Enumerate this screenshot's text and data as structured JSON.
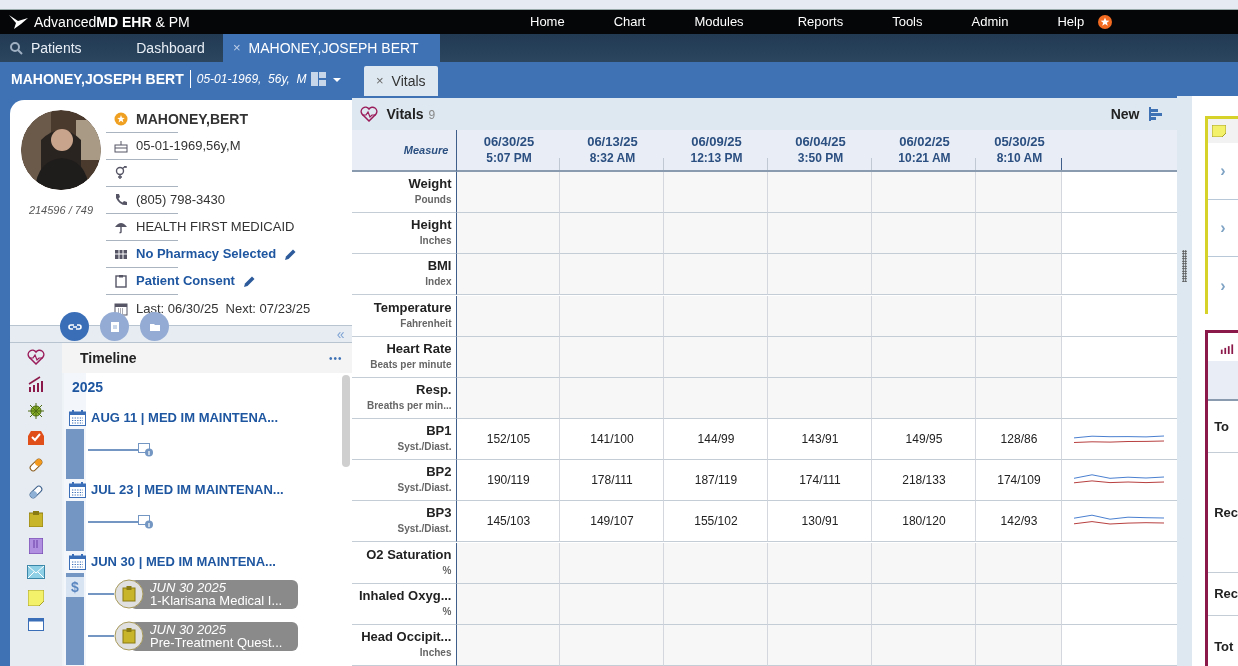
{
  "app": {
    "brand": "Advanced**MD EHR**  &  PM",
    "menu": [
      "Home",
      "Chart",
      "Modules",
      "Reports",
      "Tools",
      "Admin",
      "Help"
    ]
  },
  "tabs": [
    {
      "label": "Patients",
      "kind": "search",
      "selected": false
    },
    {
      "label": "Dashboard",
      "kind": "plain",
      "selected": false
    },
    {
      "label": "MAHONEY,JOSEPH BERT",
      "kind": "closable",
      "close": "×",
      "selected": true
    }
  ],
  "patient_bar": {
    "name": "MAHONEY,JOSEPH BERT",
    "details": "05-01-1969,  56y,  M"
  },
  "content_tabs": [
    {
      "label": "Vitals",
      "close": "×",
      "selected": true
    }
  ],
  "patient_card": {
    "account": "214596 / 749",
    "fields": [
      {
        "kind": "star",
        "text": "MAHONEY,BERT",
        "editable": false
      },
      {
        "kind": "cake",
        "text": "05-01-1969,56y,M",
        "editable": false
      },
      {
        "kind": "gender",
        "editable": false
      },
      {
        "kind": "phone",
        "text": "(805) 798-3430",
        "editable": false
      },
      {
        "kind": "umbrella",
        "text": "HEALTH FIRST MEDICAID",
        "editable": false
      },
      {
        "kind": "pharmacy",
        "text": "No Pharmacy Selected",
        "editable": true
      },
      {
        "kind": "clipboard",
        "text": "Patient Consent",
        "editable": true
      },
      {
        "kind": "calendar",
        "text": "Last: 06/30/25  Next: 07/23/25",
        "editable": false
      }
    ],
    "actions": [
      {
        "kind": "link",
        "selected": true
      },
      {
        "kind": "form",
        "selected": false
      },
      {
        "kind": "folder",
        "selected": false
      }
    ],
    "collapse": "«"
  },
  "timeline": {
    "title": "Timeline",
    "menu": "•••",
    "year": "2025",
    "entries": [
      {
        "title": "AUG 11 | MED IM MAINTENA...",
        "items": [
          {
            "kind": "info"
          }
        ]
      },
      {
        "title": "JUL 23 | MED IM MAINTENAN...",
        "items": [
          {
            "kind": "info"
          }
        ]
      },
      {
        "title": "JUN 30 | MED IM MAINTENA...",
        "badge": "$",
        "items": [
          {
            "kind": "document",
            "date": "JUN 30 2025",
            "text": "1-Klarisana Medical I..."
          },
          {
            "kind": "document",
            "date": "JUN 30 2025",
            "text": "Pre-Treatment Quest..."
          }
        ]
      }
    ]
  },
  "vitals": {
    "title": "Vitals",
    "count": "9",
    "new": "New",
    "measure": "Measure",
    "columns": [
      {
        "date": "06/30/25",
        "time": "5:07 PM"
      },
      {
        "date": "06/13/25",
        "time": "8:32 AM"
      },
      {
        "date": "06/09/25",
        "time": "12:13 PM"
      },
      {
        "date": "06/04/25",
        "time": "3:50 PM"
      },
      {
        "date": "06/02/25",
        "time": "10:21 AM"
      },
      {
        "date": "05/30/25",
        "time": "8:10 AM"
      }
    ],
    "rows": [
      {
        "name": "Weight",
        "unit": "Pounds"
      },
      {
        "name": "Height",
        "unit": "Inches"
      },
      {
        "name": "BMI",
        "unit": "Index"
      },
      {
        "name": "Temperature",
        "unit": "Fahrenheit"
      },
      {
        "name": "Heart Rate",
        "unit": "Beats per minute"
      },
      {
        "name": "Resp.",
        "unit": "Breaths per min..."
      },
      {
        "name": "BP1",
        "unit": "Syst./Diast.",
        "values": [
          "152/105",
          "141/100",
          "144/99",
          "143/91",
          "149/95",
          "128/86"
        ]
      },
      {
        "name": "BP2",
        "unit": "Syst./Diast.",
        "values": [
          "190/119",
          "178/111",
          "187/119",
          "174/111",
          "218/133",
          "174/109"
        ]
      },
      {
        "name": "BP3",
        "unit": "Syst./Diast.",
        "values": [
          "145/103",
          "149/107",
          "155/102",
          "130/91",
          "180/120",
          "142/93"
        ]
      },
      {
        "name": "O2 Saturation",
        "unit": "%"
      },
      {
        "name": "Inhaled Oxyg...",
        "unit": "%"
      },
      {
        "name": "Head Occipit...",
        "unit": "Inches"
      }
    ]
  },
  "right_panel": {
    "chevrons": [
      "›",
      "›",
      "›"
    ],
    "labels": [
      "To",
      "Rec",
      "Rec",
      "Tot"
    ]
  }
}
